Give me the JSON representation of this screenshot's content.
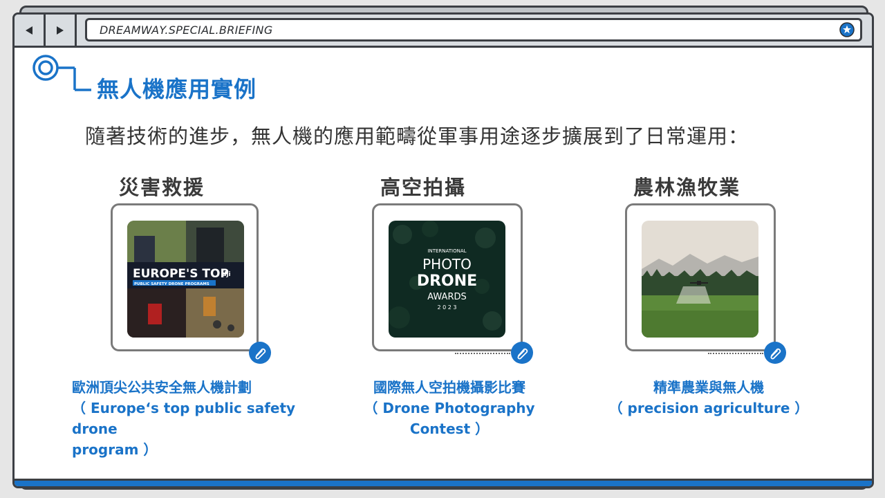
{
  "browser": {
    "url": "DREAMWAY.SPECIAL.BRIEFING"
  },
  "slide": {
    "title": "無人機應用實例",
    "subtitle": "隨著技術的進步，無人機的應用範疇從軍事用途逐步擴展到了日常運用："
  },
  "cards": [
    {
      "label": "災害救援",
      "img_title": "EUROPE'S TOP",
      "img_sub": "PUBLIC SAFETY DRONE PROGRAMS",
      "img_brand": "dji",
      "caption_line1": "歐洲頂尖公共安全無人機計劃",
      "caption_line2": "（ Europe‘s top public safety drone",
      "caption_line3": "program ）"
    },
    {
      "label": "高空拍攝",
      "img_line1": "INTERNATIONAL",
      "img_line2": "PHOTO",
      "img_line3": "DRONE",
      "img_line4": "AWARDS",
      "img_line5": "2 0 2 3",
      "caption_line1": "國際無人空拍機攝影比賽",
      "caption_line2": "（ Drone Photography Contest ）"
    },
    {
      "label": "農林漁牧業",
      "caption_line1": "精準農業與無人機",
      "caption_line2": "（ precision agriculture ）"
    }
  ],
  "colors": {
    "accent": "#1a73c8",
    "frame": "#3c3f44",
    "toolbar": "#d9dde1"
  }
}
